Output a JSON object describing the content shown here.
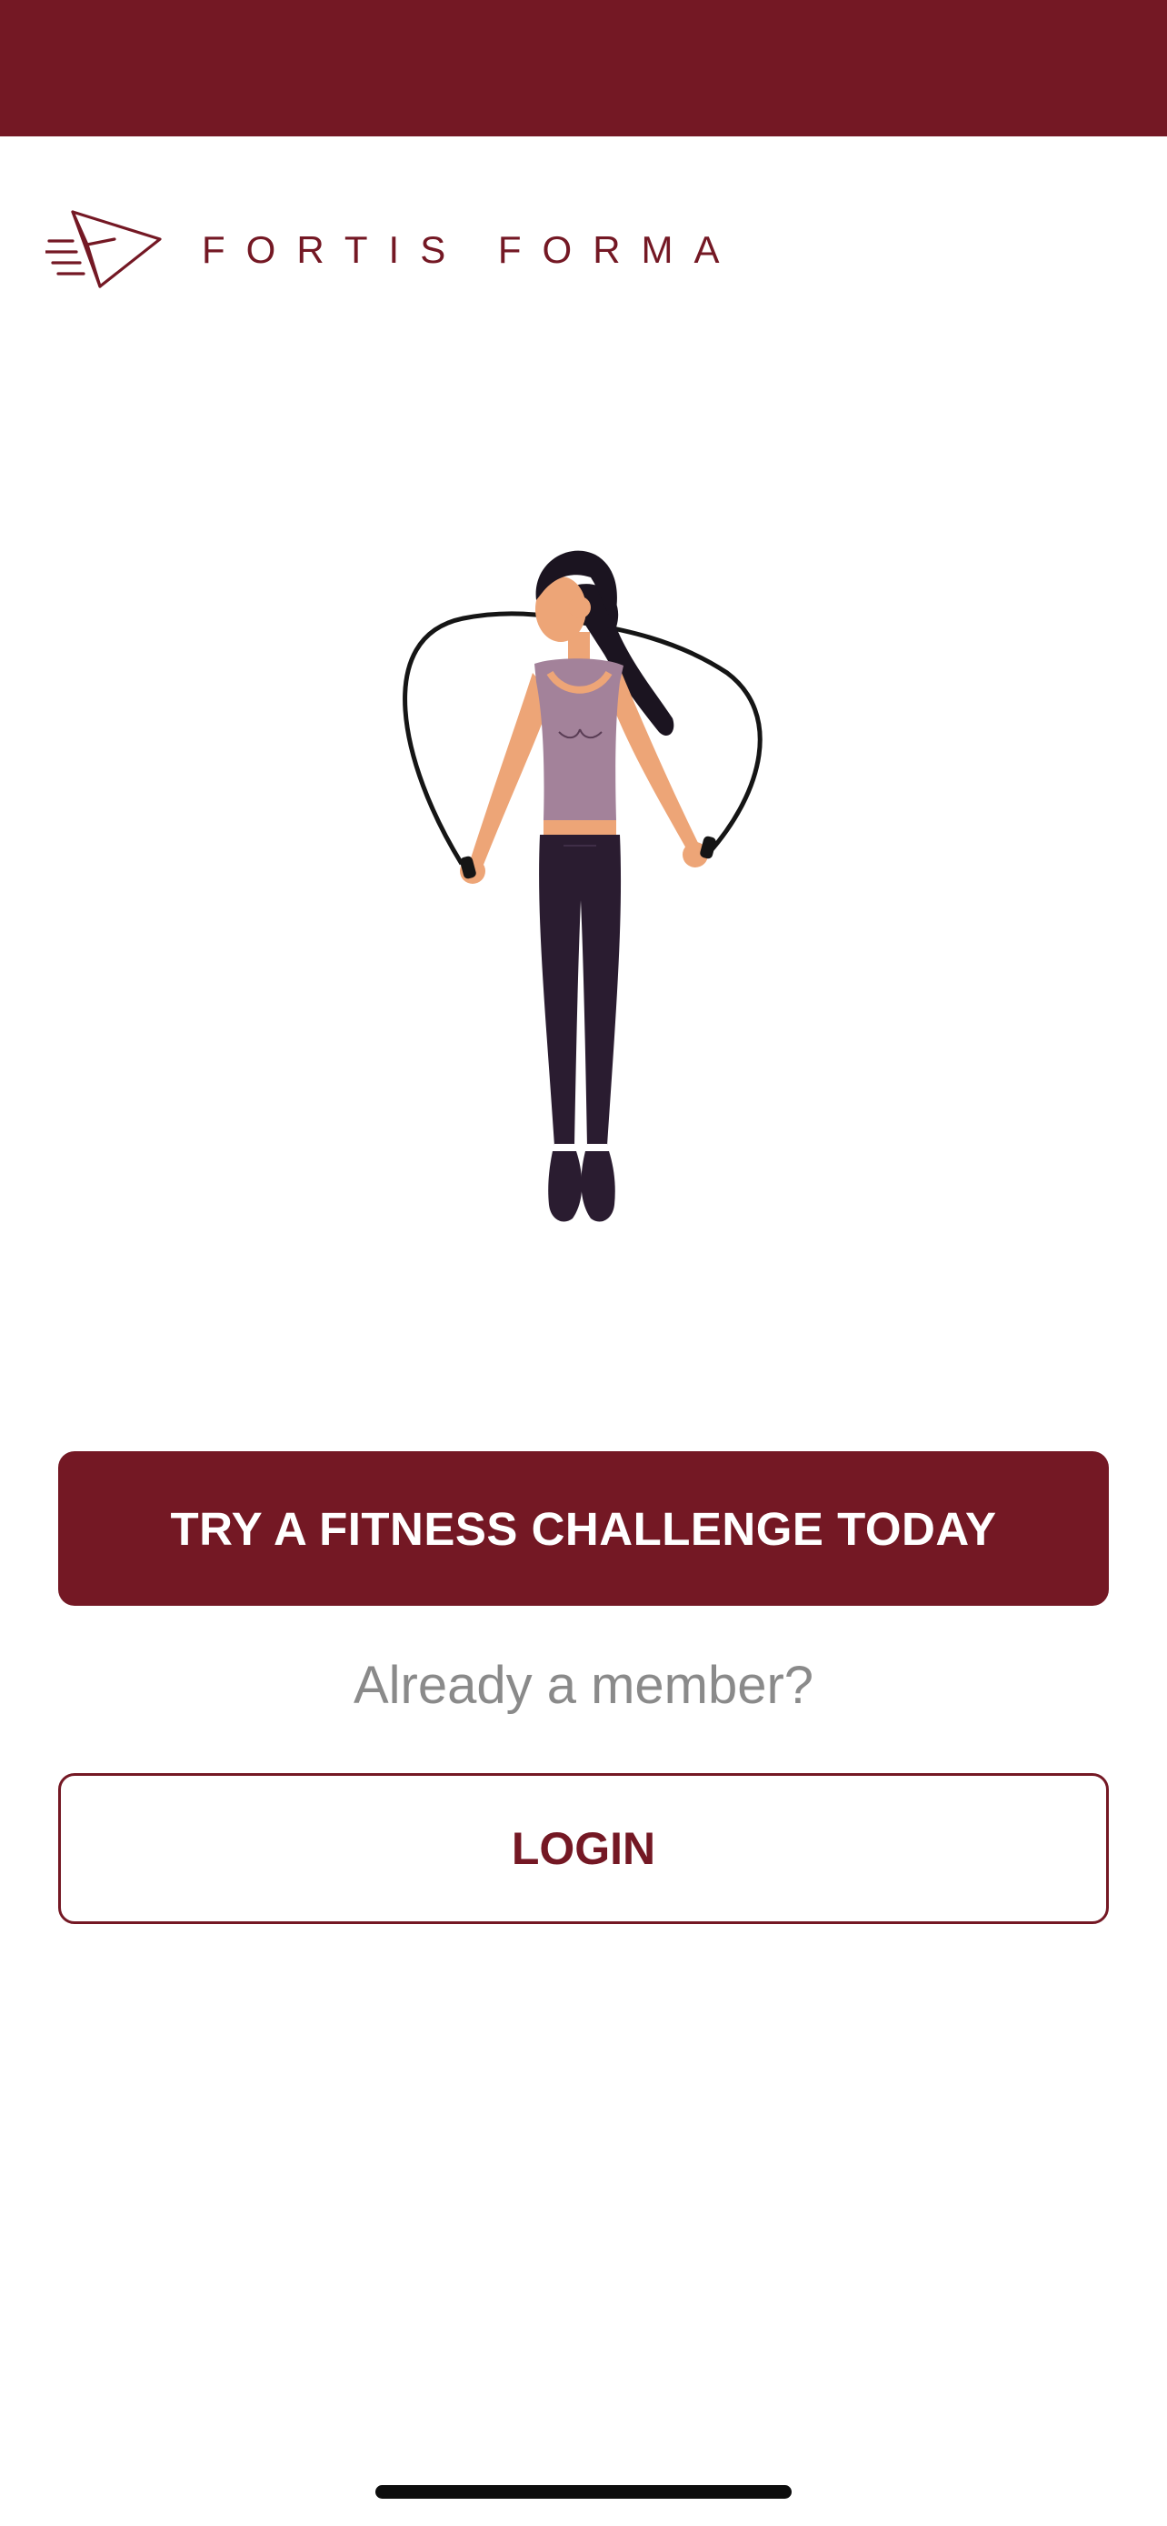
{
  "brand": {
    "name": "FORTIS FORMA",
    "logo_icon": "paper-plane-arrow-icon",
    "color": "#741824"
  },
  "hero": {
    "illustration": "woman-jumping-rope-illustration"
  },
  "cta": {
    "label": "TRY A FITNESS CHALLENGE TODAY"
  },
  "member_prompt": "Already a member?",
  "login": {
    "label": "LOGIN"
  },
  "colors": {
    "primary": "#741824",
    "muted_text": "#8a8a8a",
    "background": "#ffffff"
  }
}
